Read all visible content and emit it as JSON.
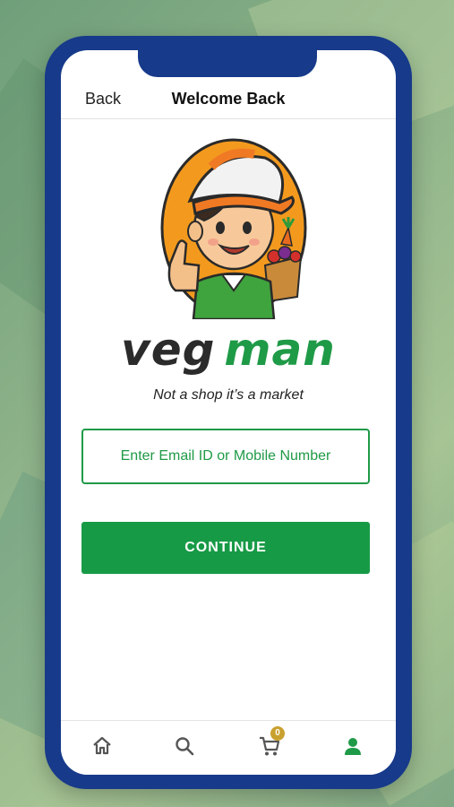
{
  "header": {
    "back_label": "Back",
    "title": "Welcome Back"
  },
  "brand": {
    "name_part1": "veg",
    "name_part2": "man",
    "tagline": "Not a shop it’s a market"
  },
  "login": {
    "placeholder": "Enter Email ID or Mobile Number",
    "value": "",
    "continue_label": "CONTINUE"
  },
  "bottom_nav": {
    "items": [
      {
        "name": "home",
        "icon": "home-icon",
        "active": false
      },
      {
        "name": "search",
        "icon": "search-icon",
        "active": false
      },
      {
        "name": "cart",
        "icon": "cart-icon",
        "active": false,
        "badge": "0"
      },
      {
        "name": "account",
        "icon": "user-icon",
        "active": true
      }
    ]
  },
  "colors": {
    "brand_green": "#1f9a47",
    "frame_blue": "#173a8a",
    "badge_gold": "#c9a12e",
    "icon_gray": "#555555"
  }
}
